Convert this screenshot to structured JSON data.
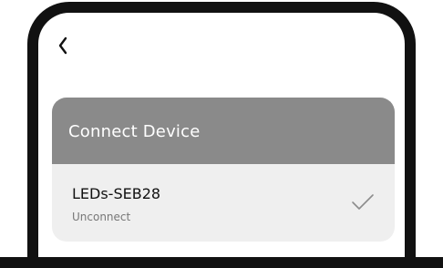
{
  "nav": {
    "back_icon": "chevron-left-icon"
  },
  "card": {
    "title": "Connect Device",
    "devices": [
      {
        "name": "LEDs-SEB28",
        "status": "Unconnect",
        "selected_icon": "checkmark-icon"
      }
    ]
  },
  "colors": {
    "frame": "#111111",
    "header_bg": "#8a8a8a",
    "card_bg": "#efefef",
    "status_text": "#777777"
  }
}
